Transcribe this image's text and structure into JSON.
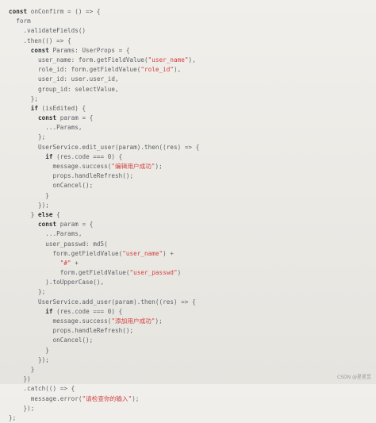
{
  "code": {
    "lines": [
      [
        {
          "t": "const",
          "c": "kw"
        },
        {
          "t": " onConfirm = () => {",
          "c": "pl"
        }
      ],
      [
        {
          "t": "  form",
          "c": "pl"
        }
      ],
      [
        {
          "t": "    .validateFields()",
          "c": "pl"
        }
      ],
      [
        {
          "t": "    .then(() => {",
          "c": "pl"
        }
      ],
      [
        {
          "t": "      ",
          "c": "pl"
        },
        {
          "t": "const",
          "c": "kw"
        },
        {
          "t": " Params: UserProps = {",
          "c": "pl"
        }
      ],
      [
        {
          "t": "        user_name: form.getFieldValue(",
          "c": "pl"
        },
        {
          "t": "\"user_name\"",
          "c": "str"
        },
        {
          "t": "),",
          "c": "pl"
        }
      ],
      [
        {
          "t": "        role_id: form.getFieldValue(",
          "c": "pl"
        },
        {
          "t": "\"role_id\"",
          "c": "str"
        },
        {
          "t": "),",
          "c": "pl"
        }
      ],
      [
        {
          "t": "        user_id: user.user_id,",
          "c": "pl"
        }
      ],
      [
        {
          "t": "        group_id: selectValue,",
          "c": "pl"
        }
      ],
      [
        {
          "t": "      };",
          "c": "pl"
        }
      ],
      [
        {
          "t": "      ",
          "c": "pl"
        },
        {
          "t": "if",
          "c": "kw"
        },
        {
          "t": " (isEdited) {",
          "c": "pl"
        }
      ],
      [
        {
          "t": "        ",
          "c": "pl"
        },
        {
          "t": "const",
          "c": "kw"
        },
        {
          "t": " param = {",
          "c": "pl"
        }
      ],
      [
        {
          "t": "          ...Params,",
          "c": "pl"
        }
      ],
      [
        {
          "t": "        };",
          "c": "pl"
        }
      ],
      [
        {
          "t": "        UserService.edit_user(param).then((res) => {",
          "c": "pl"
        }
      ],
      [
        {
          "t": "          ",
          "c": "pl"
        },
        {
          "t": "if",
          "c": "kw"
        },
        {
          "t": " (res.code === 0) {",
          "c": "pl"
        }
      ],
      [
        {
          "t": "            message.success(",
          "c": "pl"
        },
        {
          "t": "\"编辑用户成功\"",
          "c": "str"
        },
        {
          "t": ");",
          "c": "pl"
        }
      ],
      [
        {
          "t": "            props.handleRefresh();",
          "c": "pl"
        }
      ],
      [
        {
          "t": "            onCancel();",
          "c": "pl"
        }
      ],
      [
        {
          "t": "          }",
          "c": "pl"
        }
      ],
      [
        {
          "t": "        });",
          "c": "pl"
        }
      ],
      [
        {
          "t": "      } ",
          "c": "pl"
        },
        {
          "t": "else",
          "c": "kw"
        },
        {
          "t": " {",
          "c": "pl"
        }
      ],
      [
        {
          "t": "        ",
          "c": "pl"
        },
        {
          "t": "const",
          "c": "kw"
        },
        {
          "t": " param = {",
          "c": "pl"
        }
      ],
      [
        {
          "t": "          ...Params,",
          "c": "pl"
        }
      ],
      [
        {
          "t": "          user_passwd: md5(",
          "c": "pl"
        }
      ],
      [
        {
          "t": "            form.getFieldValue(",
          "c": "pl"
        },
        {
          "t": "\"user_name\"",
          "c": "str"
        },
        {
          "t": ") +",
          "c": "pl"
        }
      ],
      [
        {
          "t": "              ",
          "c": "pl"
        },
        {
          "t": "\"#\"",
          "c": "str"
        },
        {
          "t": " +",
          "c": "pl"
        }
      ],
      [
        {
          "t": "              form.getFieldValue(",
          "c": "pl"
        },
        {
          "t": "\"user_passwd\"",
          "c": "str"
        },
        {
          "t": ")",
          "c": "pl"
        }
      ],
      [
        {
          "t": "          ).toUpperCase(),",
          "c": "pl"
        }
      ],
      [
        {
          "t": "        };",
          "c": "pl"
        }
      ],
      [
        {
          "t": "        UserService.add_user(param).then((res) => {",
          "c": "pl"
        }
      ],
      [
        {
          "t": "          ",
          "c": "pl"
        },
        {
          "t": "if",
          "c": "kw"
        },
        {
          "t": " (res.code === 0) {",
          "c": "pl"
        }
      ],
      [
        {
          "t": "            message.success(",
          "c": "pl"
        },
        {
          "t": "\"添加用户成功\"",
          "c": "str"
        },
        {
          "t": ");",
          "c": "pl"
        }
      ],
      [
        {
          "t": "            props.handleRefresh();",
          "c": "pl"
        }
      ],
      [
        {
          "t": "            onCancel();",
          "c": "pl"
        }
      ],
      [
        {
          "t": "          }",
          "c": "pl"
        }
      ],
      [
        {
          "t": "        });",
          "c": "pl"
        }
      ],
      [
        {
          "t": "      }",
          "c": "pl"
        }
      ],
      [
        {
          "t": "    })",
          "c": "pl"
        }
      ],
      [
        {
          "t": "    .catch(() => {",
          "c": "pl"
        }
      ],
      [
        {
          "t": "      message.error(",
          "c": "pl"
        },
        {
          "t": "\"请检查你的输入\"",
          "c": "str"
        },
        {
          "t": ");",
          "c": "pl"
        }
      ],
      [
        {
          "t": "    });",
          "c": "pl"
        }
      ],
      [
        {
          "t": "};",
          "c": "pl"
        }
      ]
    ]
  },
  "watermark": "CSDN @星星昱",
  "colors": {
    "background": "#eceae5",
    "plain": "#555a60",
    "keyword": "#2a2f36",
    "string": "#d13f3f"
  }
}
